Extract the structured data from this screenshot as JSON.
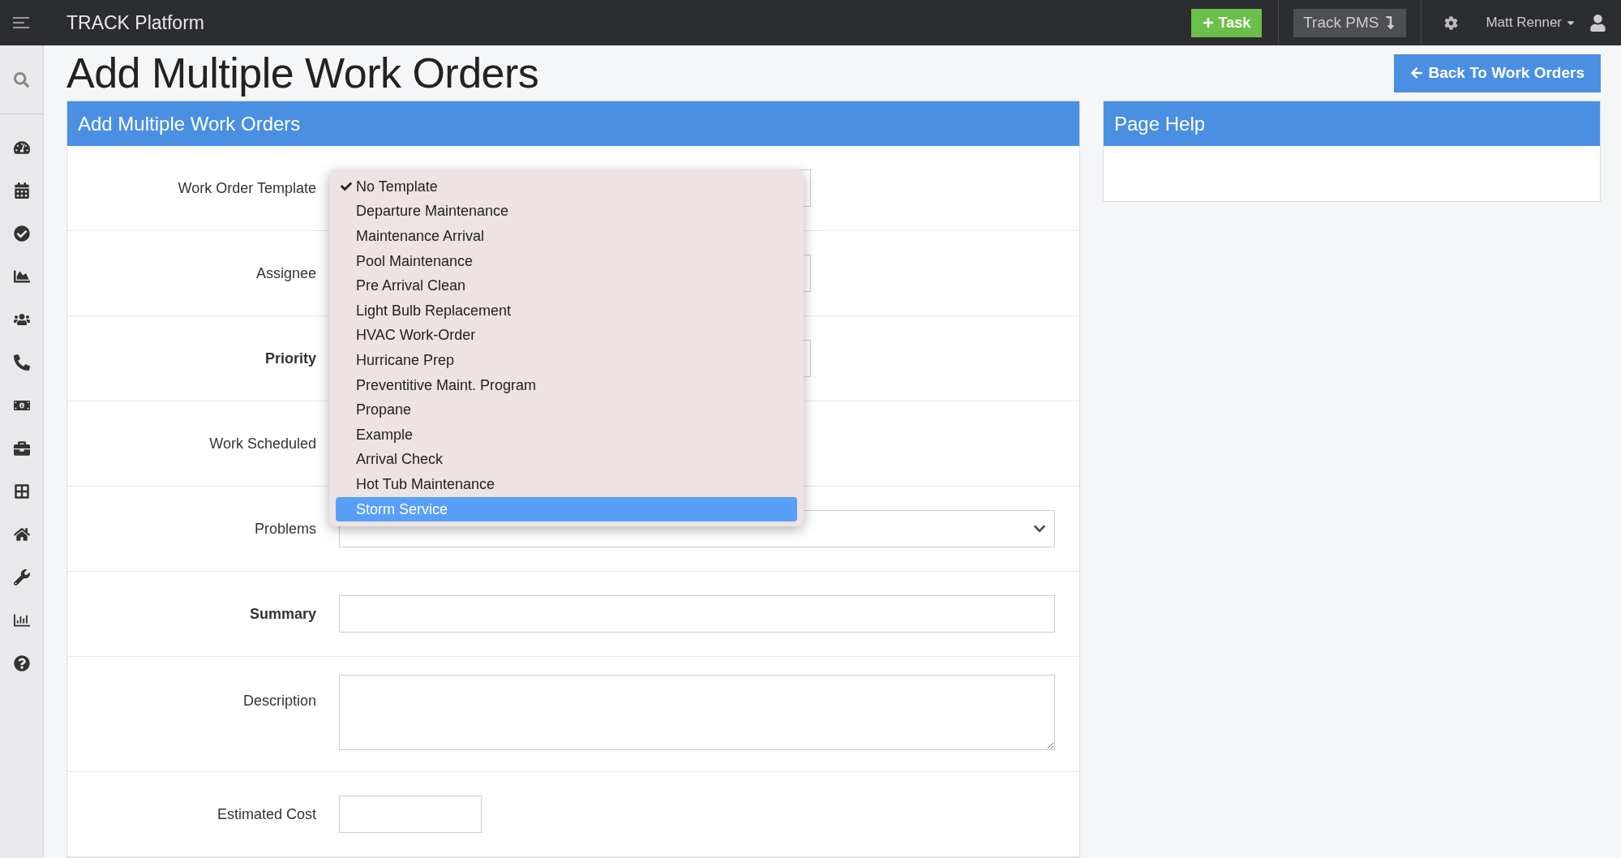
{
  "topbar": {
    "title": "TRACK Platform",
    "task_button": "Task",
    "pms_button": "Track PMS",
    "user": "Matt Renner"
  },
  "page": {
    "title": "Add Multiple Work Orders",
    "back_button": "Back To Work Orders"
  },
  "form_panel": {
    "title": "Add Multiple Work Orders",
    "fields": [
      {
        "label": "Work Order Template",
        "kind": "select",
        "required": false
      },
      {
        "label": "Assignee",
        "kind": "select",
        "required": false
      },
      {
        "label": "Priority",
        "kind": "select",
        "required": true
      },
      {
        "label": "Work Scheduled",
        "kind": "hidden",
        "required": false
      },
      {
        "label": "Problems",
        "kind": "multiselect",
        "required": false
      },
      {
        "label": "Summary",
        "kind": "text",
        "required": true
      },
      {
        "label": "Description",
        "kind": "textarea",
        "required": false
      },
      {
        "label": "Estimated Cost",
        "kind": "short",
        "required": false
      }
    ],
    "dropdown": {
      "options": [
        {
          "label": "No Template",
          "checked": true,
          "selected": false
        },
        {
          "label": "Departure Maintenance",
          "checked": false,
          "selected": false
        },
        {
          "label": "Maintenance Arrival",
          "checked": false,
          "selected": false
        },
        {
          "label": "Pool Maintenance",
          "checked": false,
          "selected": false
        },
        {
          "label": "Pre Arrival Clean",
          "checked": false,
          "selected": false
        },
        {
          "label": "Light Bulb Replacement",
          "checked": false,
          "selected": false
        },
        {
          "label": "HVAC Work-Order",
          "checked": false,
          "selected": false
        },
        {
          "label": "Hurricane Prep",
          "checked": false,
          "selected": false
        },
        {
          "label": "Preventitive Maint. Program",
          "checked": false,
          "selected": false
        },
        {
          "label": "Propane",
          "checked": false,
          "selected": false
        },
        {
          "label": "Example",
          "checked": false,
          "selected": false
        },
        {
          "label": "Arrival Check",
          "checked": false,
          "selected": false
        },
        {
          "label": "Hot Tub Maintenance",
          "checked": false,
          "selected": false
        },
        {
          "label": "Storm Service",
          "checked": false,
          "selected": true
        }
      ]
    }
  },
  "help_panel": {
    "title": "Page Help"
  }
}
